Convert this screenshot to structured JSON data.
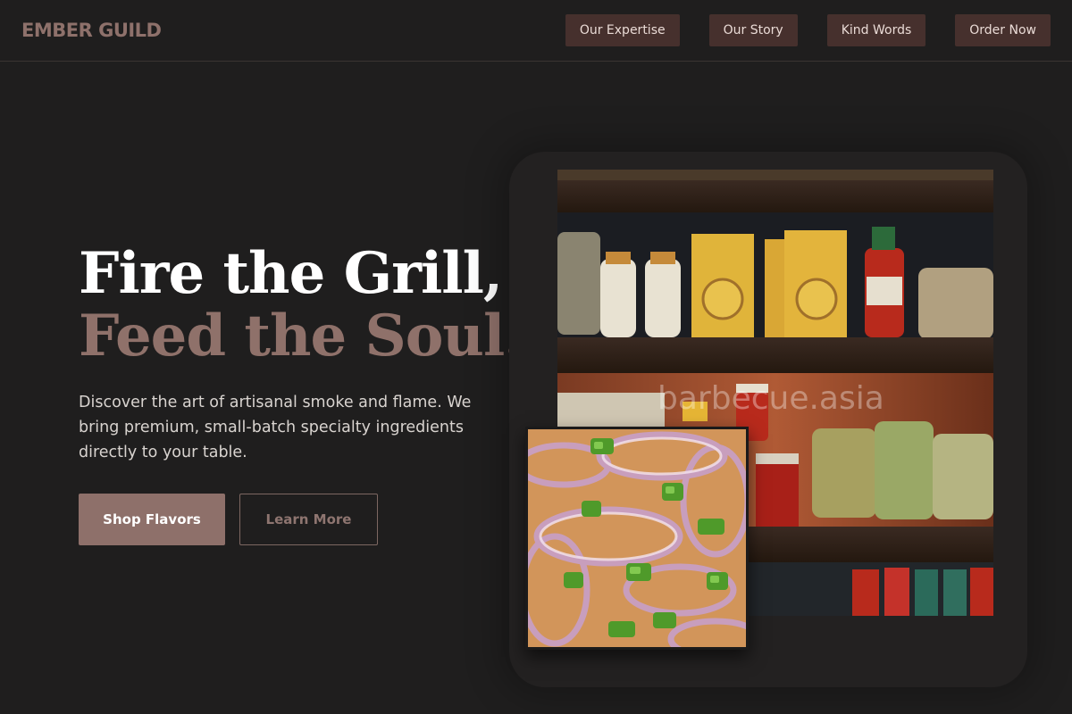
{
  "header": {
    "logo": "EMBER GUILD",
    "nav": [
      {
        "label": "Our Expertise"
      },
      {
        "label": "Our Story"
      },
      {
        "label": "Kind Words"
      },
      {
        "label": "Order Now"
      }
    ]
  },
  "hero": {
    "headline_line1": "Fire the Grill,",
    "headline_line2": "Feed the Soul.",
    "description": "Discover the art of artisanal smoke and flame. We bring premium, small-batch specialty ingredients directly to your table.",
    "primary_cta": "Shop Flavors",
    "secondary_cta": "Learn More"
  },
  "images": {
    "shelf_watermark": "barbecue.asia"
  },
  "colors": {
    "background": "#1f1e1e",
    "accent": "#8e706a",
    "nav_button": "#46302d"
  }
}
